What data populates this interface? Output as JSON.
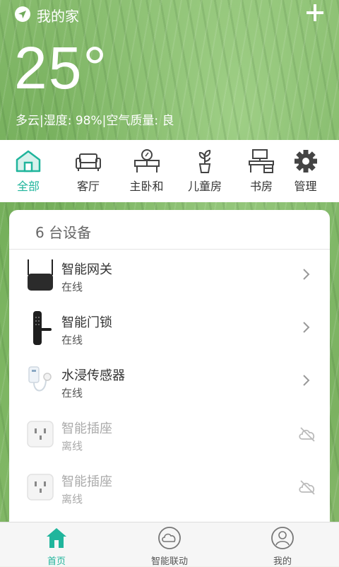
{
  "header": {
    "home_name": "我的家",
    "add_icon": "plus-icon",
    "location_icon": "navigation-arrow-icon"
  },
  "weather": {
    "temperature": "25°",
    "condition": "多云",
    "humidity": "湿度: 98%",
    "air_quality": "空气质量: 良",
    "separator": "|"
  },
  "rooms": [
    {
      "label": "全部",
      "icon": "house-icon",
      "active": true
    },
    {
      "label": "客厅",
      "icon": "sofa-icon",
      "active": false
    },
    {
      "label": "主卧和",
      "icon": "vanity-table-icon",
      "active": false
    },
    {
      "label": "儿童房",
      "icon": "potted-plant-icon",
      "active": false
    },
    {
      "label": "书房",
      "icon": "desk-icon",
      "active": false
    },
    {
      "label": "管理",
      "icon": "gear-icon",
      "active": false
    }
  ],
  "device_list": {
    "title": "6 台设备",
    "devices": [
      {
        "name": "智能网关",
        "status": "在线",
        "icon": "gateway-icon",
        "online": true
      },
      {
        "name": "智能门锁",
        "status": "在线",
        "icon": "door-lock-icon",
        "online": true
      },
      {
        "name": "水浸传感器",
        "status": "在线",
        "icon": "water-sensor-icon",
        "online": true
      },
      {
        "name": "智能插座",
        "status": "离线",
        "icon": "smart-plug-icon",
        "online": false
      },
      {
        "name": "智能插座",
        "status": "离线",
        "icon": "smart-plug-icon",
        "online": false
      }
    ]
  },
  "tabs": [
    {
      "label": "首页",
      "icon": "home-icon",
      "active": true
    },
    {
      "label": "智能联动",
      "icon": "cloud-icon",
      "active": false
    },
    {
      "label": "我的",
      "icon": "person-icon",
      "active": false
    }
  ],
  "colors": {
    "accent": "#20b59c",
    "offline_text": "#aaaaaa"
  }
}
